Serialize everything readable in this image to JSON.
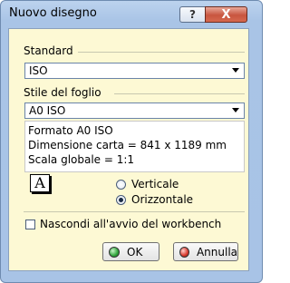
{
  "window": {
    "title": "Nuovo disegno",
    "help_label": "?",
    "close_label": "X"
  },
  "standard": {
    "label": "Standard",
    "selected": "ISO"
  },
  "sheet_style": {
    "label": "Stile del foglio",
    "selected": "A0 ISO"
  },
  "info": {
    "format": "Formato A0 ISO",
    "paper_size": "Dimensione carta = 841 x 1189 mm",
    "scale": "Scala globale = 1:1"
  },
  "orientation": {
    "options": [
      {
        "label": "Verticale",
        "checked": false
      },
      {
        "label": "Orizzontale",
        "checked": true
      }
    ],
    "icon_letter": "A"
  },
  "hide_at_startup": {
    "label": "Nascondi all'avvio del workbench",
    "checked": false
  },
  "buttons": {
    "ok": "OK",
    "cancel": "Annulla"
  },
  "colors": {
    "title_bar": "#a9c4e6",
    "client_bg": "#fdf9d4",
    "close_button": "#c8553f",
    "ok_indicator": "#2fa43a",
    "cancel_indicator": "#d8392c"
  }
}
